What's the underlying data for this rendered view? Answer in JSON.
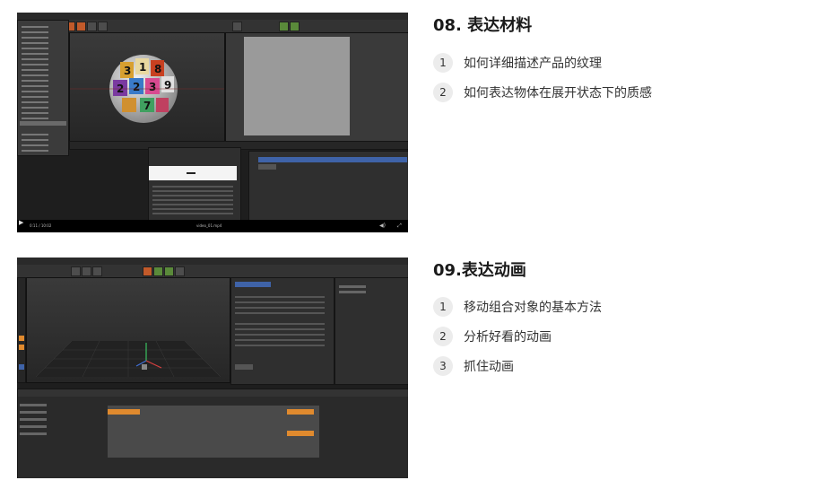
{
  "lessons": [
    {
      "title": "08. 表达材料",
      "items": [
        {
          "num": "1",
          "text": "如何详细描述产品的纹理"
        },
        {
          "num": "2",
          "text": "如何表达物体在展开状态下的质感"
        }
      ]
    },
    {
      "title": "09.表达动画",
      "items": [
        {
          "num": "1",
          "text": "移动组合对象的基本方法"
        },
        {
          "num": "2",
          "text": "分析好看的动画"
        },
        {
          "num": "3",
          "text": "抓住动画"
        }
      ]
    }
  ],
  "video1": {
    "time": "0:11 / 10:02",
    "file": "video_01.mp4",
    "ball_numbers": [
      "3",
      "1",
      "8",
      "2",
      "2",
      "3",
      "9",
      "7"
    ]
  },
  "colors": {
    "app_bg": "#2f2f2f",
    "viewport_bg": "#3a3a3a",
    "accent_orange": "#e08a2e",
    "highlight_blue": "#3f63a8",
    "badge_bg": "#ececec"
  }
}
